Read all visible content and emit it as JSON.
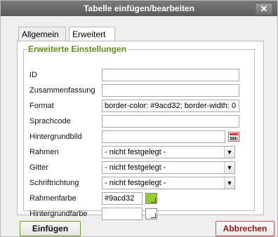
{
  "window": {
    "title": "Tabelle einfügen/bearbeiten",
    "close": "✕"
  },
  "tabs": [
    {
      "label": "Allgemein"
    },
    {
      "label": "Erweitert"
    }
  ],
  "section": {
    "title": "Erweiterte Einstellungen"
  },
  "fields": [
    {
      "label": "ID",
      "value": ""
    },
    {
      "label": "Zusammenfassung",
      "value": ""
    },
    {
      "label": "Format",
      "value": "border-color: #9acd32; border-width: 0"
    },
    {
      "label": "Sprachcode",
      "value": ""
    },
    {
      "label": "Hintergrundbild",
      "value": ""
    },
    {
      "label": "Rahmen",
      "value": "- nicht festgelegt -"
    },
    {
      "label": "Gitter",
      "value": "- nicht festgelegt -"
    },
    {
      "label": "Schriftrichtung",
      "value": "- nicht festgelegt -"
    },
    {
      "label": "Rahmenfarbe",
      "value": "#9acd32"
    },
    {
      "label": "Hintergrundfarbe",
      "value": ""
    }
  ],
  "colors": {
    "accent": "#9acd32",
    "legend": "#5d8f21",
    "cancel": "#9d1111"
  },
  "buttons": {
    "insert": "Einfügen",
    "cancel": "Abbrechen"
  }
}
